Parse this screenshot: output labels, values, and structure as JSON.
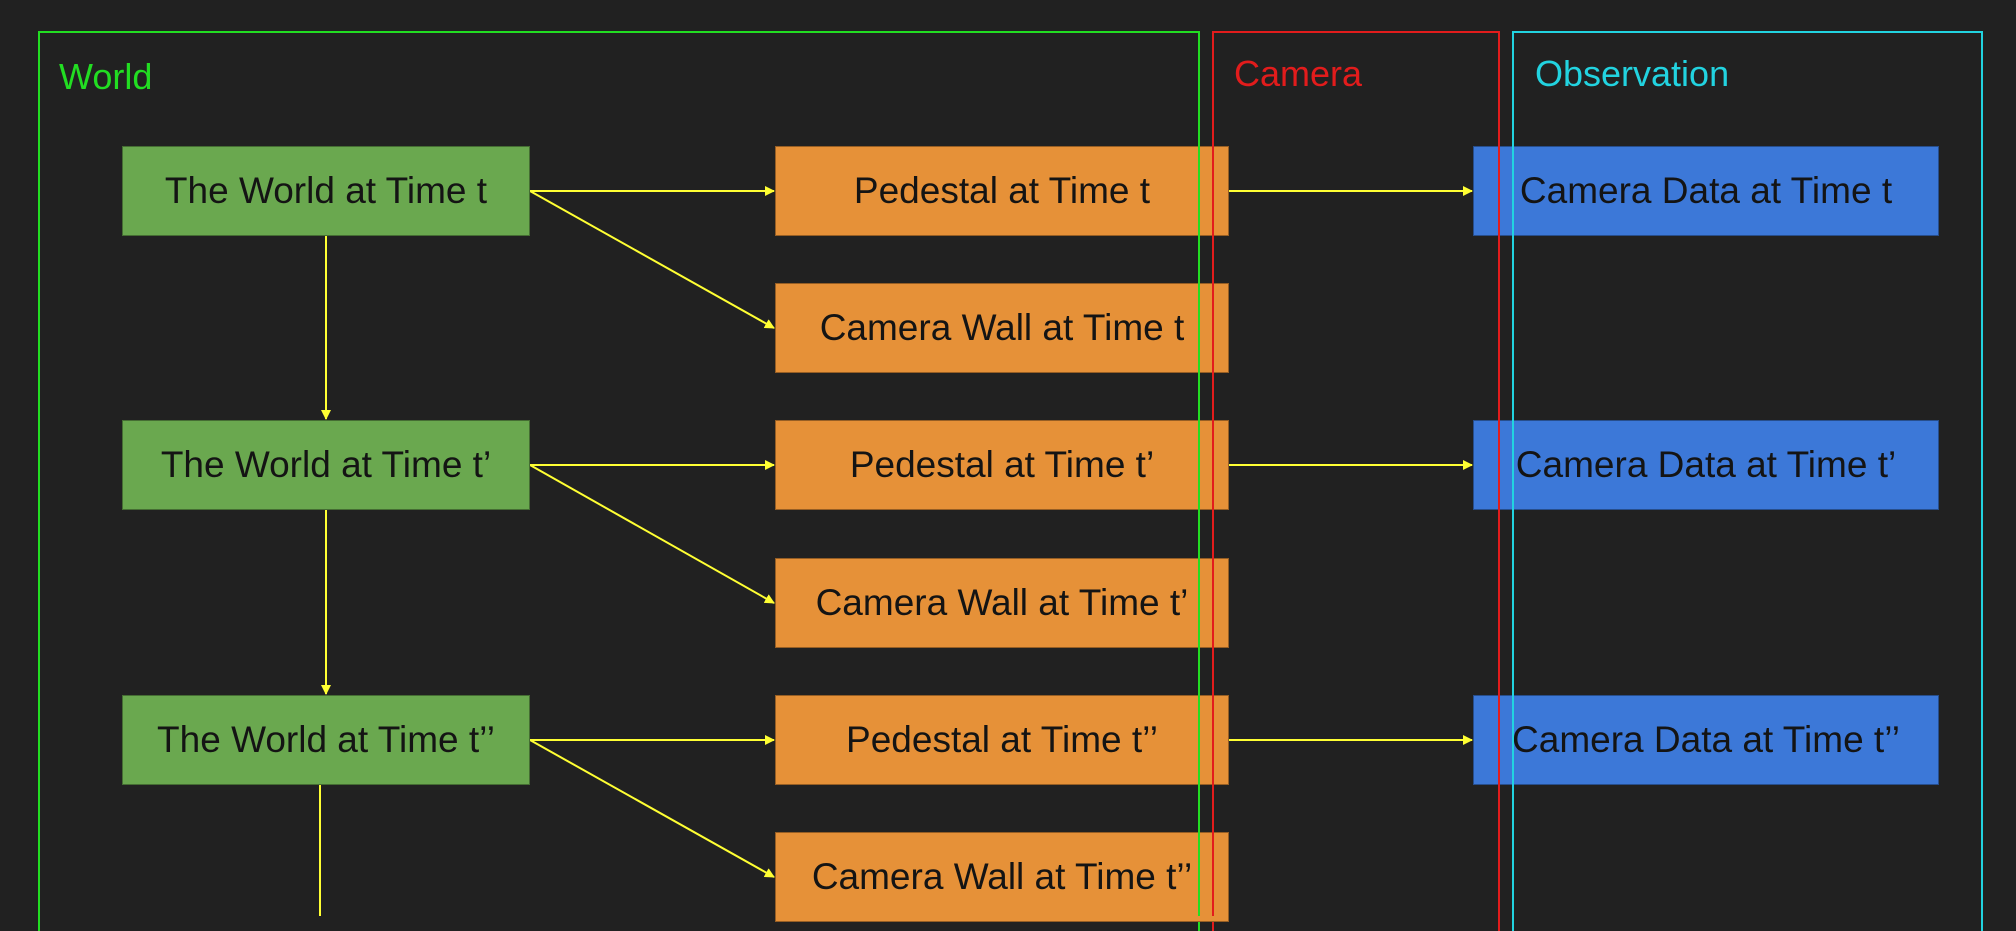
{
  "colors": {
    "background": "#212121",
    "world_border": "#22dd22",
    "camera_border": "#e21c1c",
    "observation_border": "#22d3e0",
    "world_node": "#6aa84f",
    "pedestal_node": "#e69138",
    "camera_data_node": "#3c78d8",
    "arrow": "#ffff33"
  },
  "regions": {
    "world": {
      "label": "World"
    },
    "camera": {
      "label": "Camera"
    },
    "observation": {
      "label": "Observation"
    }
  },
  "nodes": {
    "world_t": "The World at Time t",
    "world_t1": "The World at Time t’",
    "world_t2": "The World at Time t’’",
    "pedestal_t": "Pedestal at Time t",
    "pedestal_t1": "Pedestal at Time t’",
    "pedestal_t2": "Pedestal at Time t’’",
    "wall_t": "Camera Wall at Time t",
    "wall_t1": "Camera Wall at Time t’",
    "wall_t2": "Camera Wall at Time t’’",
    "data_t": "Camera Data at Time t",
    "data_t1": "Camera Data at Time t’",
    "data_t2": "Camera Data at Time t’’"
  },
  "edges": [
    [
      "world_t",
      "pedestal_t"
    ],
    [
      "world_t",
      "wall_t"
    ],
    [
      "world_t",
      "world_t1"
    ],
    [
      "world_t1",
      "pedestal_t1"
    ],
    [
      "world_t1",
      "wall_t1"
    ],
    [
      "world_t1",
      "world_t2"
    ],
    [
      "world_t2",
      "pedestal_t2"
    ],
    [
      "world_t2",
      "wall_t2"
    ],
    [
      "world_t2",
      "continues"
    ],
    [
      "pedestal_t",
      "data_t"
    ],
    [
      "pedestal_t1",
      "data_t1"
    ],
    [
      "pedestal_t2",
      "data_t2"
    ]
  ]
}
